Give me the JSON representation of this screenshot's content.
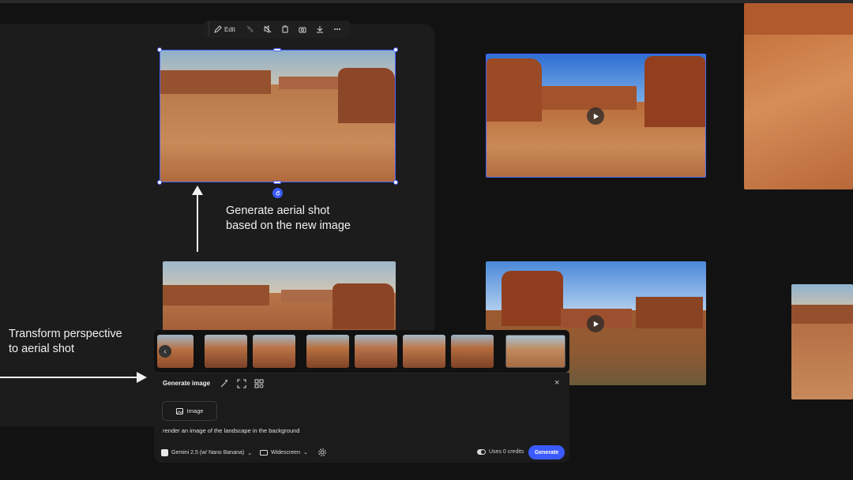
{
  "toolbar": {
    "edit_label": "Edit",
    "icons": [
      "pencil-icon",
      "link-off-icon",
      "mute-icon",
      "crop-icon",
      "camera-icon",
      "download-icon",
      "more-icon"
    ]
  },
  "annotations": {
    "aerial_line1": "Generate aerial shot",
    "aerial_line2": "based on the new image",
    "transform_line1": "Transform perspective",
    "transform_line2": "to aerial shot"
  },
  "filmstrip": {
    "nav_label": "‹",
    "thumb_count": 8
  },
  "generate_panel": {
    "title": "Generate image",
    "close_label": "×",
    "image_chip_label": "Image",
    "prompt": "render an image of the landscape in the background",
    "model_label": "Gemini 2.5 (w/ Nano Banana)",
    "aspect_label": "Widescreen",
    "credits_label": "Uses 0 credits",
    "generate_label": "Generate"
  },
  "colors": {
    "accent": "#3b5bff",
    "selection": "#4a64ff",
    "background": "#121212",
    "panel": "#1c1c1c"
  }
}
